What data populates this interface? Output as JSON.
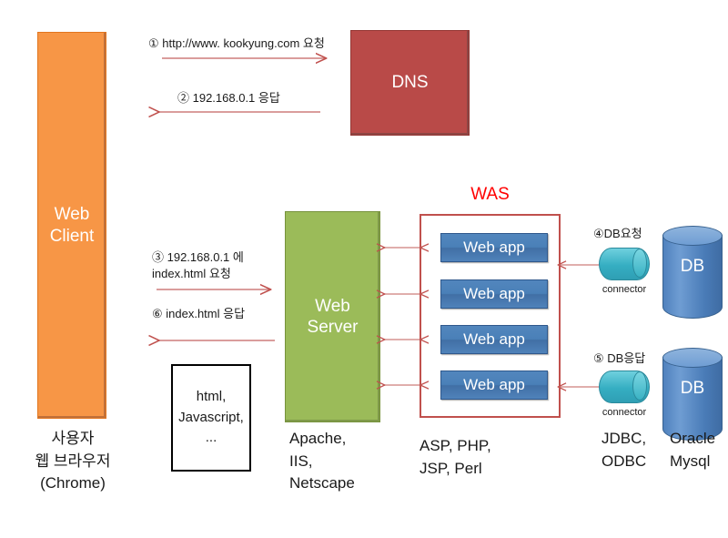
{
  "diagram": {
    "title": "Web Client / Web Server / WAS / DB request flow",
    "colors": {
      "client": "#f79646",
      "dns": "#b94a48",
      "web_server": "#9bbb59",
      "was_border": "#c0504d",
      "was_label": "#ff0000",
      "web_app": "#4f81bd",
      "connector": "#35aec2",
      "db": "#4f81bd",
      "arrow": "#c0504d"
    }
  },
  "nodes": {
    "web_client": {
      "label": "Web\nClient",
      "caption": "사용자\n웹 브라우저\n(Chrome)"
    },
    "dns": {
      "label": "DNS"
    },
    "web_server": {
      "label": "Web\nServer",
      "caption": "Apache,\nIIS,\nNetscape"
    },
    "content_box": {
      "label": "html,\nJavascript,\n..."
    },
    "was": {
      "label": "WAS",
      "caption": "ASP, PHP,\nJSP, Perl",
      "apps": [
        {
          "label": "Web app"
        },
        {
          "label": "Web app"
        },
        {
          "label": "Web app"
        },
        {
          "label": "Web app"
        }
      ]
    },
    "connectors": [
      {
        "label": "connector",
        "caption": "JDBC,\nODBC"
      },
      {
        "label": "connector"
      }
    ],
    "databases": [
      {
        "label": "DB"
      },
      {
        "label": "DB",
        "caption": "Oracle\nMysql"
      }
    ]
  },
  "steps": [
    {
      "id": "1",
      "text": "① http://www. kookyung.com 요청"
    },
    {
      "id": "2",
      "text": "② 192.168.0.1 응답"
    },
    {
      "id": "3",
      "text": "③ 192.168.0.1 에\nindex.html 요청"
    },
    {
      "id": "6",
      "text": "⑥ index.html 응답"
    },
    {
      "id": "4",
      "text": "④DB요청"
    },
    {
      "id": "5",
      "text": "⑤ DB응답"
    }
  ]
}
